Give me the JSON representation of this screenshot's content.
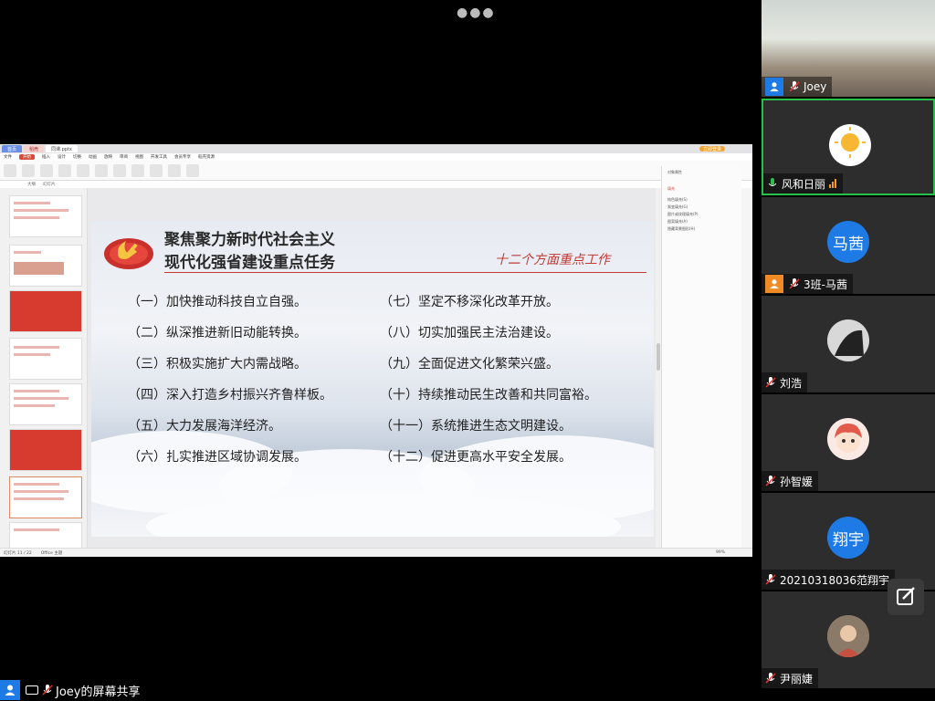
{
  "meeting": {
    "top_menu_icon": "more-dots",
    "share_label": "Joey的屏幕共享"
  },
  "app": {
    "tabs": [
      "首页",
      "稻壳",
      "同课.pptx"
    ],
    "login_label": "立即登录",
    "menu": [
      "文件",
      "开始",
      "插入",
      "设计",
      "切换",
      "动画",
      "放映",
      "审阅",
      "视图",
      "开发工具",
      "会员专享",
      "稻壳资源"
    ],
    "active_menu": "开始",
    "subtabs": [
      "大纲",
      "幻灯片"
    ],
    "status_left": "幻灯片 11 / 22",
    "status_theme": "Office 主题",
    "zoom": "99%",
    "panel_title": "对象属性",
    "panel_fill": "填充",
    "panel_items": [
      "纯色填充(S)",
      "渐变填充(G)",
      "图片或纹理填充(P)",
      "图案填充(A)",
      "隐藏背景图形(H)"
    ]
  },
  "slide": {
    "title_line1": "聚焦聚力新时代社会主义",
    "title_line2": "现代化强省建设重点任务",
    "subtitle": "十二个方面重点工作",
    "left_items": [
      "（一）加快推动科技自立自强。",
      "（二）纵深推进新旧动能转换。",
      "（三）积极实施扩大内需战略。",
      "（四）深入打造乡村振兴齐鲁样板。",
      "（五）大力发展海洋经济。",
      "（六）扎实推进区域协调发展。"
    ],
    "right_items": [
      "（七）坚定不移深化改革开放。",
      "（八）切实加强民主法治建设。",
      "（九）全面促进文化繁荣兴盛。",
      "（十）持续推动民生改善和共同富裕。",
      "（十一）系统推进生态文明建设。",
      "（十二）促进更高水平安全发展。"
    ]
  },
  "participants": [
    {
      "name": "Joey",
      "type": "video-classroom",
      "icon": "user-icon"
    },
    {
      "name": "风和日丽",
      "type": "avatar-sun",
      "active": true
    },
    {
      "name": "3班-马茜",
      "type": "text-avatar",
      "avatar_text": "马茜",
      "icon": "user-icon"
    },
    {
      "name": "刘浩",
      "type": "avatar-photo"
    },
    {
      "name": "孙智媛",
      "type": "avatar-cartoon"
    },
    {
      "name": "20210318036范翔宇",
      "type": "text-avatar",
      "avatar_text": "翔宇"
    },
    {
      "name": "尹丽婕",
      "type": "avatar-photo"
    }
  ],
  "colors": {
    "accent_blue": "#1e7be6",
    "active_border": "#27c04a",
    "wps_red": "#d84a3a",
    "slide_red": "#c23b35"
  }
}
